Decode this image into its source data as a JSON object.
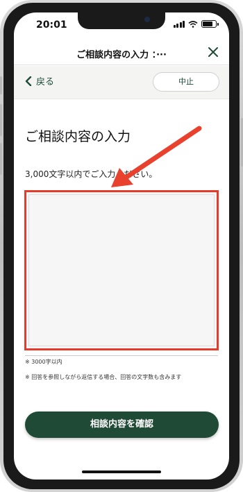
{
  "status_bar": {
    "time": "20:01"
  },
  "titlebar": {
    "title": "ご相談内容の入力 ：···"
  },
  "nav": {
    "back_label": "戻る",
    "stop_label": "中止"
  },
  "main": {
    "heading": "ご相談内容の入力",
    "instruction": "3,000文字以内でご入力ください。",
    "textarea_value": "",
    "note_limit": "※ 3000字以内",
    "note_reply": "※ 回答を参照しながら返信する場合、回答の文字数も含みます",
    "confirm_label": "相談内容を確認"
  },
  "colors": {
    "accent_green": "#1f4a36",
    "highlight_red": "#e53b2c"
  },
  "icons": [
    "chevron-left-icon",
    "close-icon",
    "signal-icon",
    "wifi-icon",
    "battery-icon",
    "arrow-annotation"
  ]
}
